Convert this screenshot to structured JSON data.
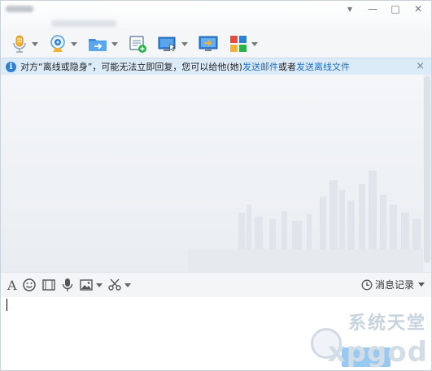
{
  "window": {
    "controls": {
      "dropdown": "▾",
      "minimize": "—",
      "maximize": "□",
      "close": "✕"
    }
  },
  "toolbar": {
    "items": [
      {
        "icon": "microphone-icon",
        "has_menu": true
      },
      {
        "icon": "webcam-icon",
        "has_menu": true
      },
      {
        "icon": "folder-transfer-icon",
        "has_menu": true
      },
      {
        "icon": "new-document-icon",
        "has_menu": false
      },
      {
        "icon": "remote-desktop-icon",
        "has_menu": true
      },
      {
        "icon": "screen-share-icon",
        "has_menu": false
      },
      {
        "icon": "apps-grid-icon",
        "has_menu": true
      }
    ]
  },
  "notice": {
    "text_before": "对方“离线或隐身”，可能无法立即回复，您可以给他(她)",
    "link_email": "发送邮件",
    "text_mid": "或者",
    "link_offline_file": "发送离线文件",
    "close": "×"
  },
  "input_toolbar": {
    "font_icon_glyph": "A",
    "history_label": "消息记录"
  },
  "watermark": {
    "text": "系统天堂",
    "logo": "xpgod"
  },
  "colors": {
    "accent": "#2f7fd3",
    "link": "#1a6fc4",
    "notice_bg": "#dcebf8"
  }
}
